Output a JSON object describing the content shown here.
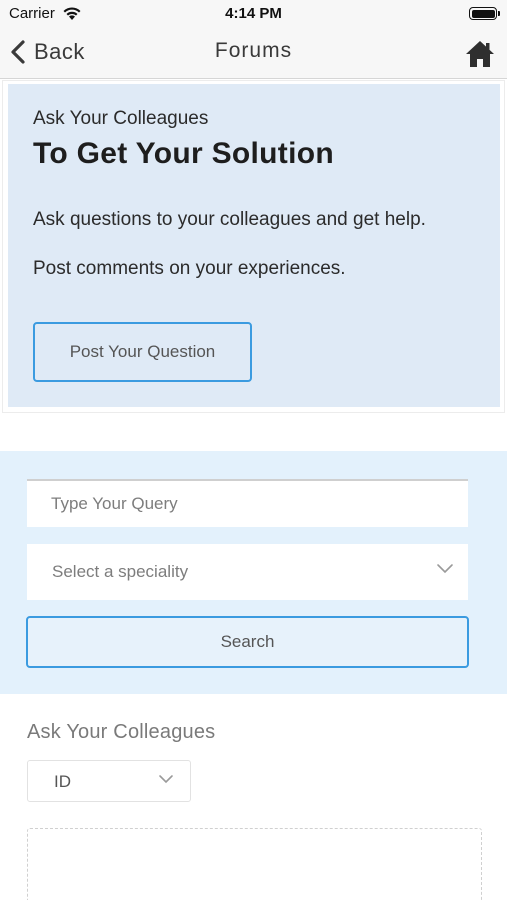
{
  "status_bar": {
    "carrier": "Carrier",
    "time": "4:14 PM"
  },
  "nav": {
    "back_label": "Back",
    "title": "Forums"
  },
  "hero": {
    "kicker": "Ask Your Colleagues",
    "title": "To Get Your Solution",
    "line1": "Ask questions to your colleagues and get help.",
    "line2": "Post comments on your experiences.",
    "post_button": "Post Your Question"
  },
  "search": {
    "query_placeholder": "Type Your Query",
    "speciality_placeholder": "Select a speciality",
    "search_button": "Search"
  },
  "ask": {
    "label": "Ask Your Colleagues",
    "id_value": "ID"
  },
  "colors": {
    "accent": "#3b9be0",
    "hero_bg": "#dfeaf6",
    "search_bg": "#e3f1fc"
  },
  "icons": [
    "wifi-icon",
    "battery-icon",
    "back-chevron-icon",
    "home-icon",
    "chevron-down-icon"
  ]
}
